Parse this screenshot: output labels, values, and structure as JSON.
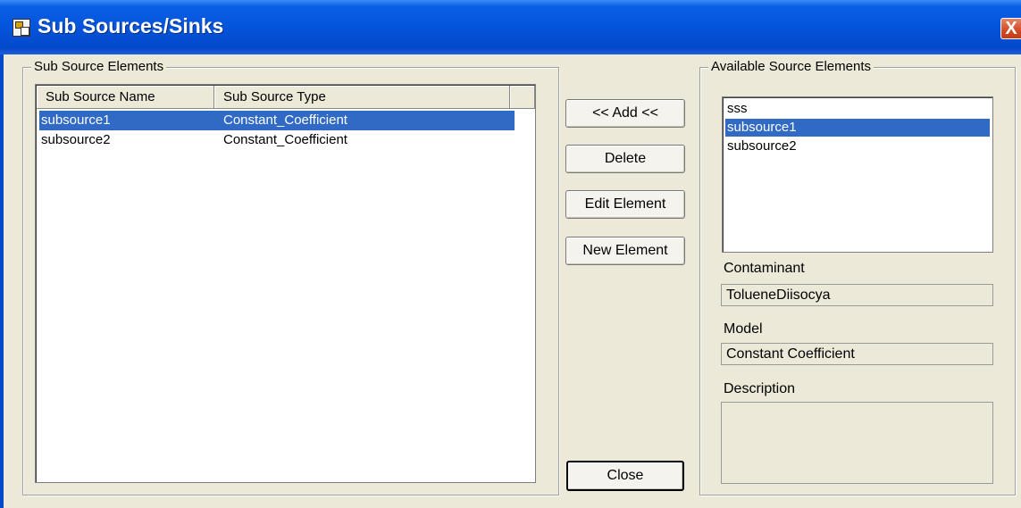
{
  "window": {
    "title": "Sub Sources/Sinks",
    "close_glyph": "X",
    "icon": "app-window-icon"
  },
  "sub_source_elements": {
    "group_label": "Sub Source Elements",
    "columns": [
      "Sub Source Name",
      "Sub Source Type"
    ],
    "rows": [
      {
        "name": "subsource1",
        "type": "Constant_Coefficient",
        "selected": true
      },
      {
        "name": "subsource2",
        "type": "Constant_Coefficient",
        "selected": false
      }
    ]
  },
  "buttons": {
    "add": "<< Add <<",
    "delete": "Delete",
    "edit": "Edit Element",
    "new": "New Element",
    "close": "Close"
  },
  "available_source_elements": {
    "group_label": "Available Source Elements",
    "items": [
      {
        "label": "sss",
        "selected": false
      },
      {
        "label": "subsource1",
        "selected": true
      },
      {
        "label": "subsource2",
        "selected": false
      }
    ]
  },
  "details": {
    "contaminant_label": "Contaminant",
    "contaminant_value": "TolueneDiisocya",
    "model_label": "Model",
    "model_value": "Constant Coefficient",
    "description_label": "Description",
    "description_value": ""
  },
  "colors": {
    "selection": "#316ac5",
    "titlebar": "#0454dc",
    "dialog_bg": "#ece9d8"
  }
}
